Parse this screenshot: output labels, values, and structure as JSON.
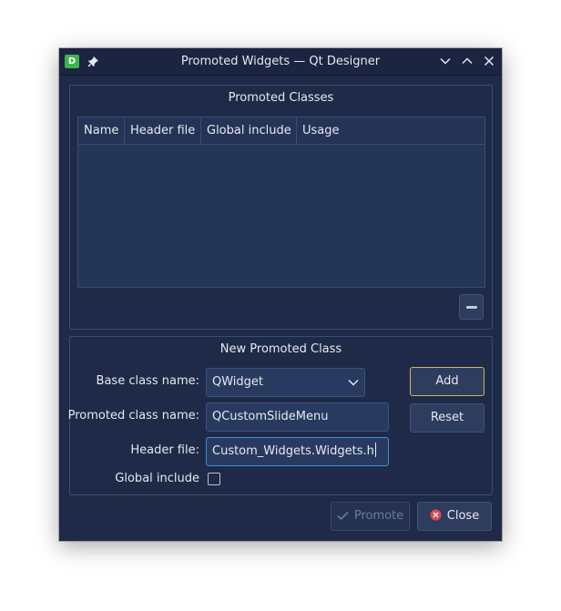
{
  "window": {
    "title": "Promoted Widgets — Qt Designer",
    "app_icon_letter": "D"
  },
  "promoted_classes": {
    "title": "Promoted Classes",
    "columns": [
      "Name",
      "Header file",
      "Global include",
      "Usage"
    ],
    "rows": []
  },
  "new_class": {
    "title": "New Promoted Class",
    "base_class_label": "Base class name:",
    "base_class_value": "QWidget",
    "promoted_class_label": "Promoted class name:",
    "promoted_class_value": "QCustomSlideMenu",
    "header_file_label": "Header file:",
    "header_file_value": "Custom_Widgets.Widgets.h",
    "global_include_label": "Global include",
    "global_include_checked": false
  },
  "buttons": {
    "add": "Add",
    "reset": "Reset",
    "promote": "Promote",
    "close": "Close"
  },
  "colors": {
    "window_bg": "#1e2a47",
    "accent_focus": "#3a8fd8",
    "default_button_border": "#d3b35f",
    "close_icon_red": "#e0484d",
    "app_icon_green": "#3fb44a"
  }
}
